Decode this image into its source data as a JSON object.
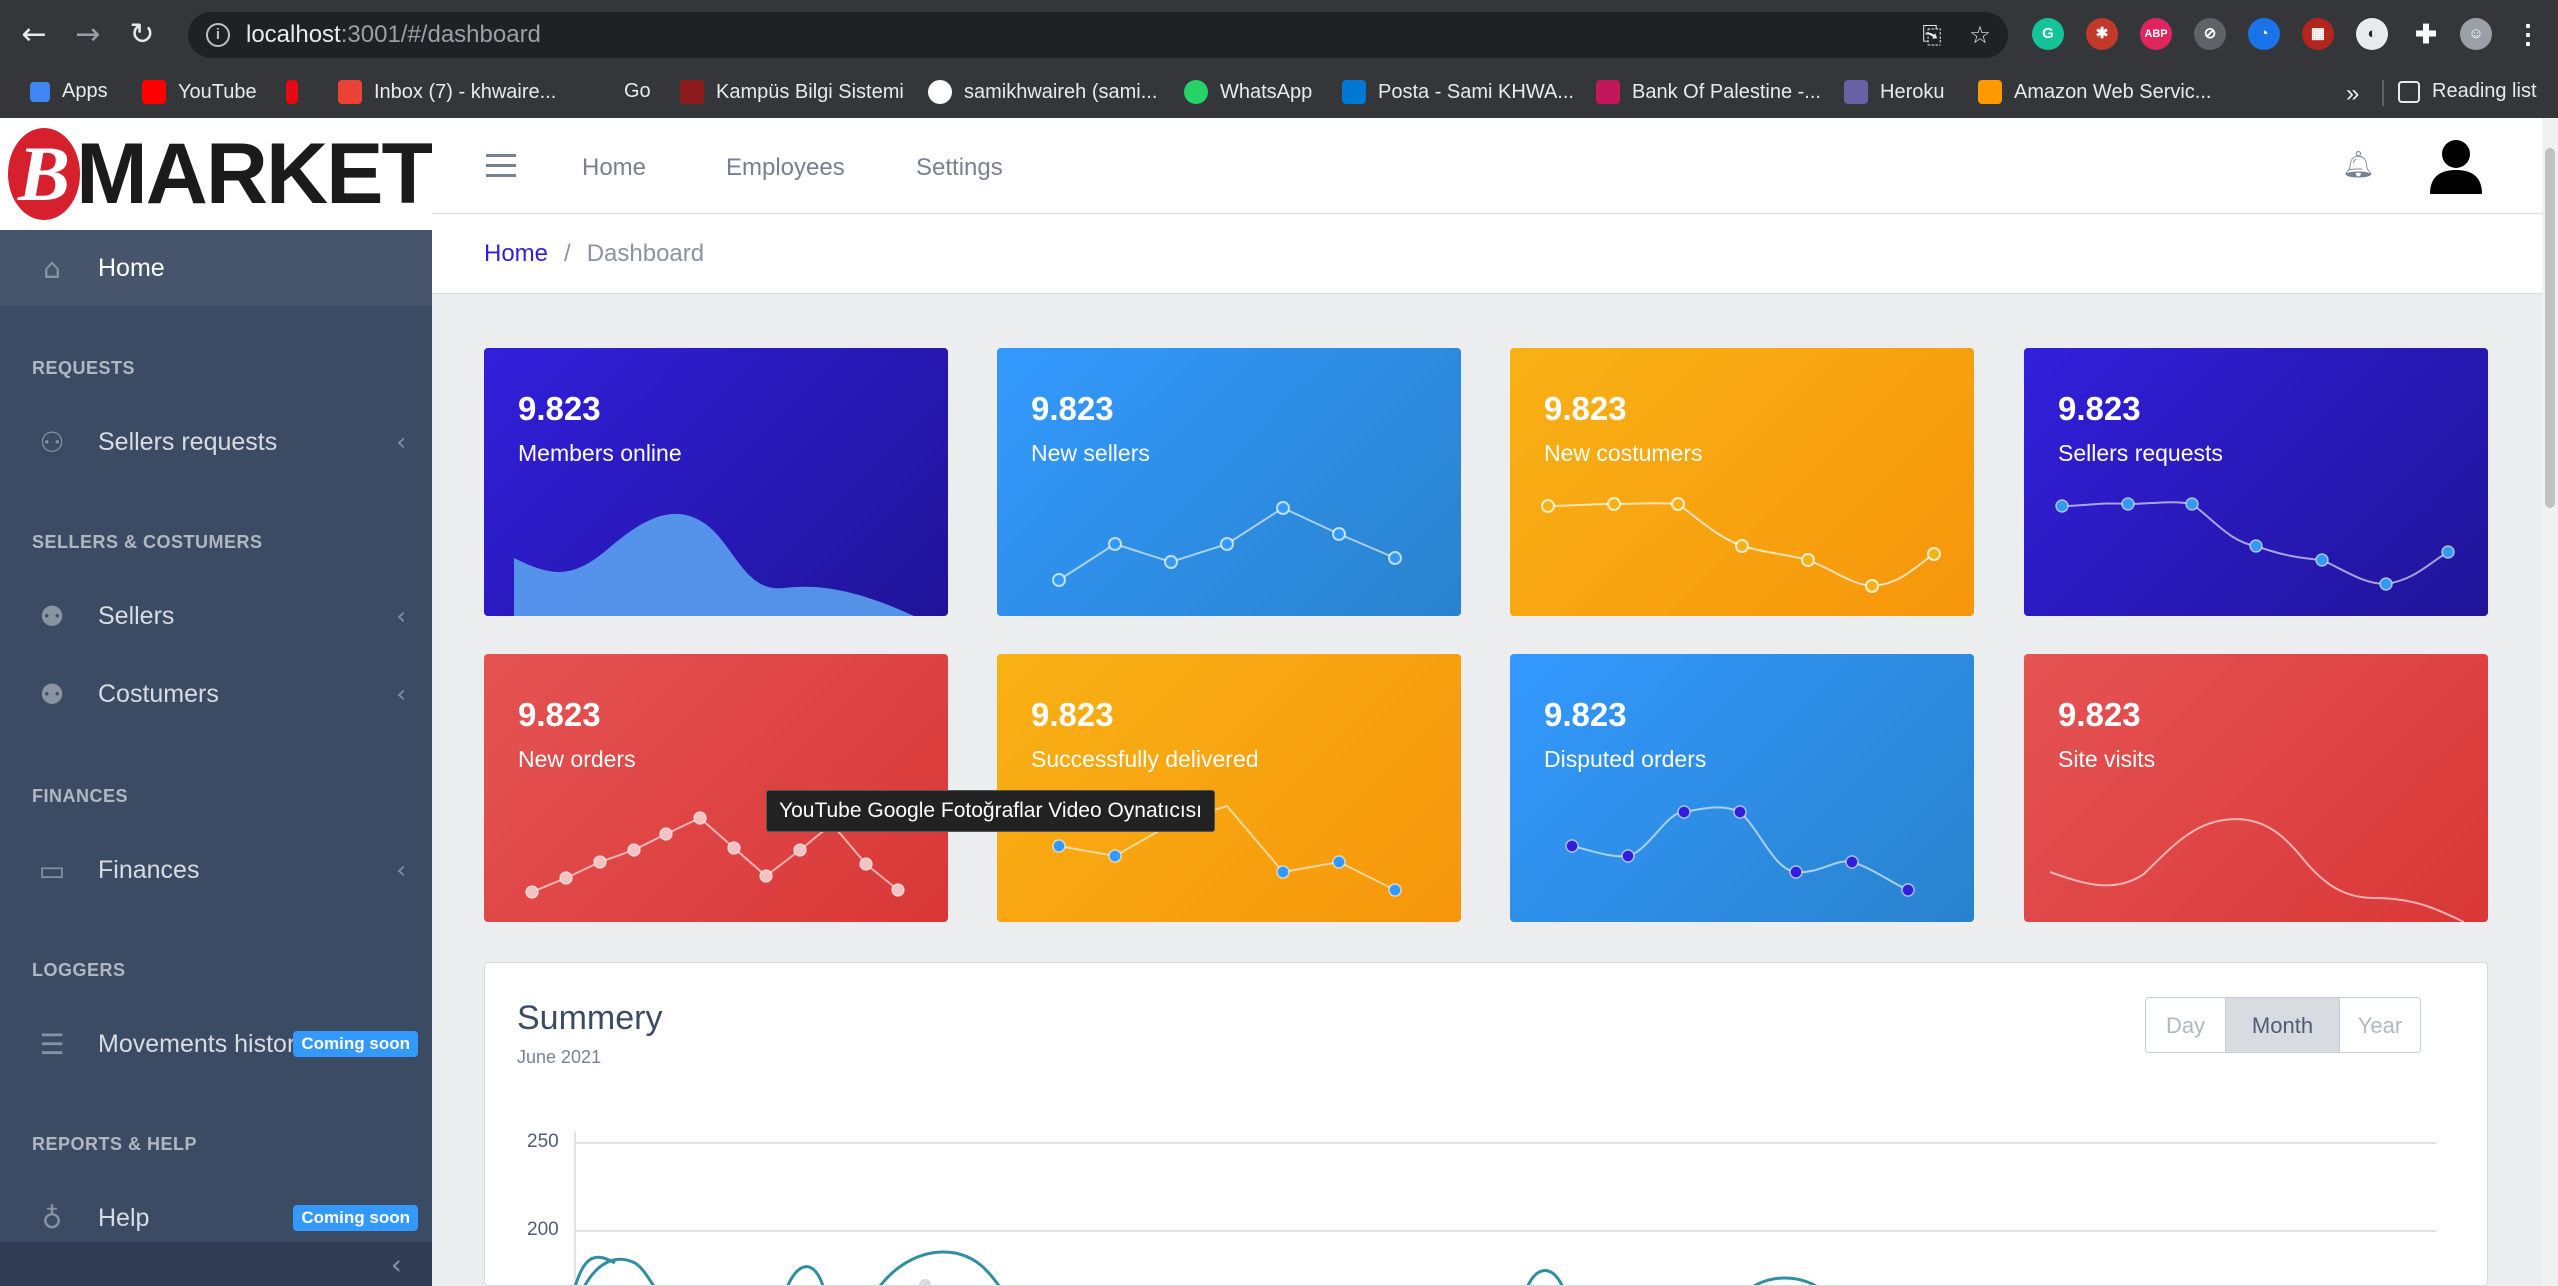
{
  "browser": {
    "url_host": "localhost",
    "url_path": ":3001/#/dashboard",
    "bookmarks": [
      {
        "label": "Apps",
        "color": "#4285f4"
      },
      {
        "label": "YouTube",
        "color": "#ff0000"
      },
      {
        "label": "",
        "color": "#e50914"
      },
      {
        "label": "Inbox (7) - khwaire...",
        "color": "#ea4335"
      },
      {
        "label": "Go",
        "color": ""
      },
      {
        "label": "Kampüs Bilgi Sistemi",
        "color": "#8b1a1a"
      },
      {
        "label": "samikhwaireh (sami...",
        "color": "#ffffff"
      },
      {
        "label": "WhatsApp",
        "color": "#25d366"
      },
      {
        "label": "Posta - Sami KHWA...",
        "color": "#0078d4"
      },
      {
        "label": "Bank Of Palestine -...",
        "color": "#c2185b"
      },
      {
        "label": "Heroku",
        "color": "#6762a6"
      },
      {
        "label": "Amazon Web Servic...",
        "color": "#ff9900"
      }
    ],
    "more": "»",
    "reading_list": "Reading list"
  },
  "brand": {
    "logo_letter": "B",
    "name": "MARKET"
  },
  "sidebar": {
    "home": "Home",
    "sections": [
      {
        "title": "REQUESTS"
      },
      {
        "title": "SELLERS & COSTUMERS"
      },
      {
        "title": "FINANCES"
      },
      {
        "title": "LOGGERS"
      },
      {
        "title": "REPORTS & HELP"
      }
    ],
    "items": [
      {
        "label": "Sellers requests"
      },
      {
        "label": "Sellers"
      },
      {
        "label": "Costumers"
      },
      {
        "label": "Finances"
      },
      {
        "label": "Movements history",
        "badge": "Coming soon"
      },
      {
        "label": "Help",
        "badge": "Coming soon"
      }
    ]
  },
  "header": {
    "nav": [
      "Home",
      "Employees",
      "Settings"
    ]
  },
  "breadcrumb": {
    "home": "Home",
    "separator": "/",
    "current": "Dashboard"
  },
  "widgets": [
    {
      "value": "9.823",
      "label": "Members online",
      "color": "#321fdb"
    },
    {
      "value": "9.823",
      "label": "New sellers",
      "color": "#39f"
    },
    {
      "value": "9.823",
      "label": "New costumers",
      "color": "#f9b115"
    },
    {
      "value": "9.823",
      "label": "Sellers requests",
      "color": "#321fdb"
    },
    {
      "value": "9.823",
      "label": "New orders",
      "color": "#e55353"
    },
    {
      "value": "9.823",
      "label": "Successfully delivered",
      "color": "#f9b115"
    },
    {
      "value": "9.823",
      "label": "Disputed orders",
      "color": "#39f"
    },
    {
      "value": "9.823",
      "label": "Site visits",
      "color": "#e55353"
    }
  ],
  "tooltip": "YouTube Google Fotoğraflar Video Oynatıcısı",
  "summary": {
    "title": "Summery",
    "subtitle": "June 2021",
    "buttons": [
      "Day",
      "Month",
      "Year"
    ],
    "selected": "Month",
    "y_ticks": [
      "250",
      "200"
    ]
  }
}
